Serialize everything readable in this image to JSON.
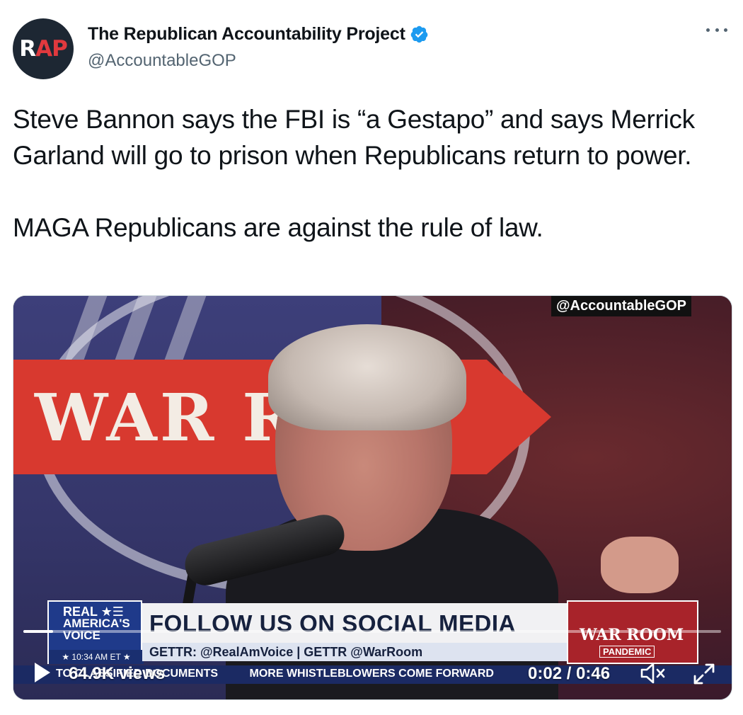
{
  "author": {
    "avatar_r": "R",
    "avatar_ap": "AP",
    "display_name": "The Republican Accountability Project",
    "handle": "@AccountableGOP",
    "verified": true
  },
  "tweet": {
    "paragraph_1": "Steve Bannon says the FBI is “a Gestapo” and says Merrick Garland will go to prison when Republicans return to power.",
    "paragraph_2": "MAGA Republicans are against the rule of law."
  },
  "video": {
    "watermark": "@AccountableGOP",
    "banner_text": "WAR R    M",
    "lower_third": {
      "logo_line1": "REAL ★☰",
      "logo_line2": "AMERICA'S",
      "logo_line3": "VOICE",
      "logo_time": "★ 10:34 AM ET ★",
      "headline": "FOLLOW US ON SOCIAL MEDIA",
      "subline": "GETTR: @RealAmVoice | GETTR @WarRoom",
      "badge_title": "WAR ROOM",
      "badge_sub": "PANDEMIC"
    },
    "ticker": {
      "item_1": "TO CLASSIFIED DOCUMENTS",
      "item_2": "MORE WHISTLEBLOWERS COME FORWARD"
    },
    "views": "64.9K views",
    "time_display": "0:02 / 0:46",
    "progress": 0.043
  },
  "colors": {
    "verified_blue": "#1d9bf0",
    "text_primary": "#0f1419",
    "text_secondary": "#536471"
  },
  "icons": {
    "verified": "verified-badge-icon",
    "more": "more-horizontal-icon",
    "play": "play-icon",
    "mute": "volume-muted-icon",
    "expand": "expand-icon"
  }
}
